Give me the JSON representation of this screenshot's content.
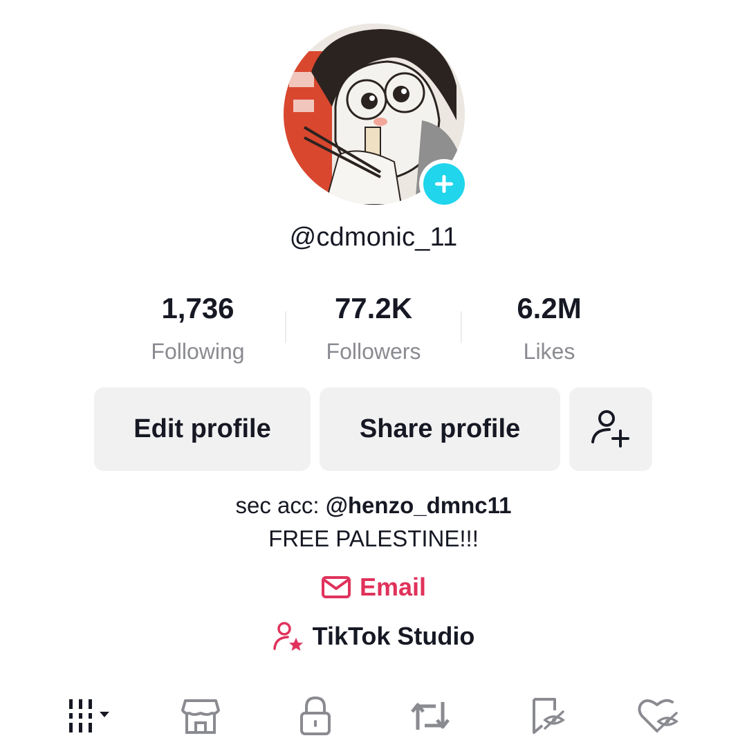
{
  "profile": {
    "username": "@cdmonic_11",
    "stats": [
      {
        "value": "1,736",
        "label": "Following"
      },
      {
        "value": "77.2K",
        "label": "Followers"
      },
      {
        "value": "6.2M",
        "label": "Likes"
      }
    ],
    "buttons": {
      "edit": "Edit profile",
      "share": "Share profile",
      "add_friend_icon": "add-friend-icon"
    },
    "bio": {
      "line1_prefix": "sec acc: ",
      "line1_handle": "@henzo_dmnc11",
      "line2": "FREE PALESTINE!!!"
    },
    "email_label": "Email",
    "studio_label": "TikTok Studio"
  },
  "tabs": [
    {
      "icon": "grid-icon",
      "active": true
    },
    {
      "icon": "shop-icon",
      "active": false
    },
    {
      "icon": "lock-icon",
      "active": false
    },
    {
      "icon": "repost-icon",
      "active": false
    },
    {
      "icon": "bookmark-hidden-icon",
      "active": false
    },
    {
      "icon": "heart-hidden-icon",
      "active": false
    }
  ],
  "colors": {
    "accent_pink": "#e0325b",
    "badge_cyan": "#20d5ec",
    "button_bg": "#f1f1f2",
    "muted_text": "#8a8b91"
  }
}
